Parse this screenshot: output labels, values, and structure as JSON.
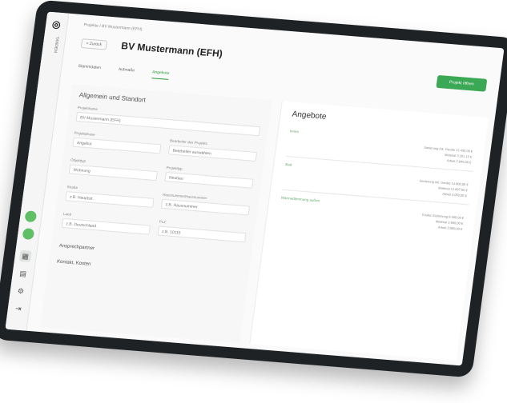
{
  "sidebar": {
    "brand": "TANDEM",
    "icons": [
      "status-dot-icon",
      "status-dot-icon",
      "grid-icon",
      "inbox-icon",
      "gear-icon",
      "logout-icon"
    ]
  },
  "header": {
    "breadcrumb": "Projekte / BV Mustermann (EFH)",
    "back_label": "< Zurück",
    "title": "BV Mustermann (EFH)",
    "cta_label": "Projekt öffnen"
  },
  "tabs": [
    {
      "label": "Stammdaten",
      "active": false
    },
    {
      "label": "Aufmaße",
      "active": false
    },
    {
      "label": "Angebote",
      "active": true
    }
  ],
  "form": {
    "section_title": "Allgemein und Standort",
    "project_name_label": "Projektname",
    "project_name_value": "BV Mustermann (EFH)",
    "phase_label": "Projektphase",
    "phase_value": "Angebot",
    "responsible_label": "Bearbeiter des Projekts",
    "responsible_placeholder": "Bearbeiter auswählen",
    "type_label": "Objekttyp",
    "type_value": "Wohnung",
    "typology_label": "Projekttyp",
    "typology_value": "Neubau",
    "street_label": "Straße",
    "street_placeholder": "z.B. Hauptstr.",
    "housenr_label": "Hausnummer/Hausnummer",
    "housenr_placeholder": "z.B. Hausnummer",
    "city_label": "Land",
    "city_placeholder": "z.B. Deutschland",
    "zip_label": "PLZ",
    "zip_placeholder": "z.B. 10115",
    "collapsed": [
      "Ansprechpartner",
      "Kontakt, Kosten"
    ]
  },
  "offers": {
    "title": "Angebote",
    "items": [
      {
        "name": "Innen",
        "details": [
          "Sanierung ink. Geräte 12.455,00 €",
          "Material 3.201,13 €",
          "Arbeit 2.945,00 €"
        ]
      },
      {
        "name": "Bad",
        "details": [
          "Sanierung ink. Geräte 14.800,00 €",
          "Material 12.897,00 €",
          "Arbeit 3.050,00 €"
        ]
      },
      {
        "name": "Wärmedämmung außen",
        "details": [
          "Kosten Dämmung 9.400,00 €",
          "Material 3.600,00 €",
          "Arbeit 3.800,00 €"
        ]
      }
    ]
  }
}
